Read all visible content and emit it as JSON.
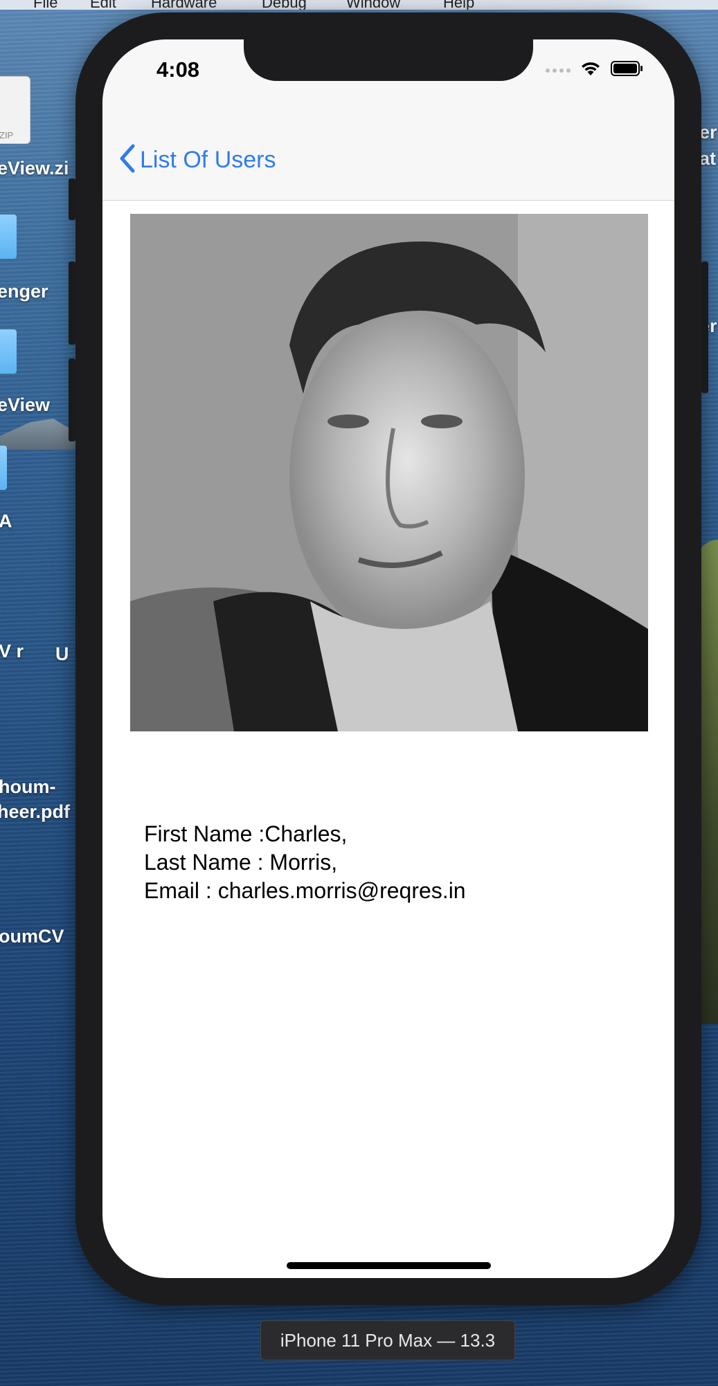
{
  "menubar": {
    "items": [
      "File",
      "Edit",
      "Hardware",
      "Debug",
      "Window",
      "Help"
    ]
  },
  "desktop": {
    "items": [
      {
        "label": "eView.zi",
        "icon": "zip-file-icon",
        "badge": "ZIP"
      },
      {
        "label": "enger",
        "icon": "folder-icon"
      },
      {
        "label": "eView",
        "icon": "folder-icon"
      },
      {
        "label": "A",
        "icon": "folder-icon"
      },
      {
        "label": "V r"
      },
      {
        "label": "U"
      },
      {
        "label": "houm-"
      },
      {
        "label": "heer.pdf"
      },
      {
        "label": "oumCV"
      }
    ],
    "right_labels": [
      "er",
      "at",
      "er"
    ]
  },
  "status_bar": {
    "time": "4:08",
    "icons": [
      "signal-icon",
      "wifi-icon",
      "battery-icon"
    ]
  },
  "nav_bar": {
    "back_label": "List Of Users",
    "back_icon": "chevron-left-icon"
  },
  "profile": {
    "image_description_icon": "user-photo",
    "first_name_line": "First Name :Charles,",
    "last_name_line": "Last Name : Morris,",
    "email_line": "Email : charles.morris@reqres.in"
  },
  "simulator": {
    "device_label": "iPhone 11 Pro Max — 13.3"
  },
  "colors": {
    "accent": "#2f7ce8",
    "phone_frame": "#1c1c1e",
    "nav_background": "#f7f7f7"
  }
}
